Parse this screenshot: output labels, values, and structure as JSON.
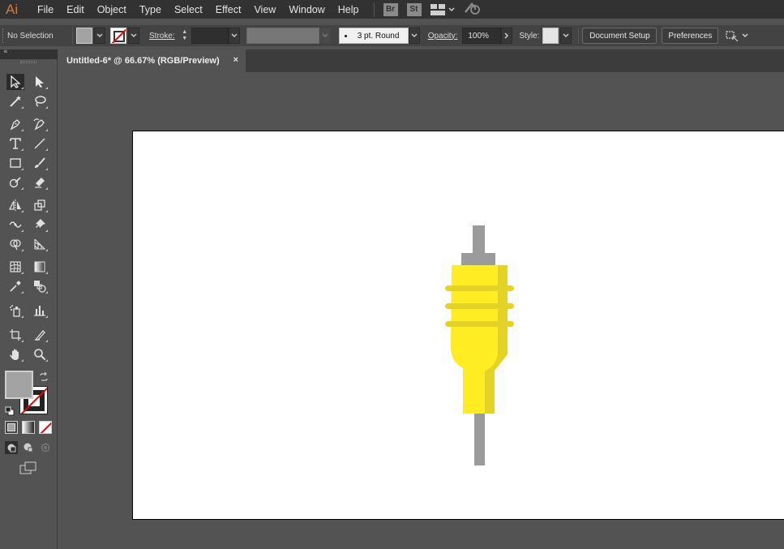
{
  "app": {
    "logo": "Ai"
  },
  "menubar": {
    "items": [
      "File",
      "Edit",
      "Object",
      "Type",
      "Select",
      "Effect",
      "View",
      "Window",
      "Help"
    ],
    "bridge": "Br",
    "stock": "St"
  },
  "controlbar": {
    "selection": "No Selection",
    "stroke_label": "Stroke:",
    "brush_label": "3 pt. Round",
    "opacity_label": "Opacity:",
    "opacity_value": "100%",
    "style_label": "Style:",
    "document_setup": "Document Setup",
    "preferences": "Preferences",
    "fill_color": "#a3a3a3"
  },
  "document": {
    "tab_title": "Untitled-6* @ 66.67% (RGB/Preview)",
    "close_symbol": "×"
  },
  "colors": {
    "connector_yellow": "#ffec23",
    "connector_shade": "#e4d227",
    "pin_gray": "#9b9b9b",
    "artboard": "#ffffff",
    "workspace": "#535353"
  }
}
